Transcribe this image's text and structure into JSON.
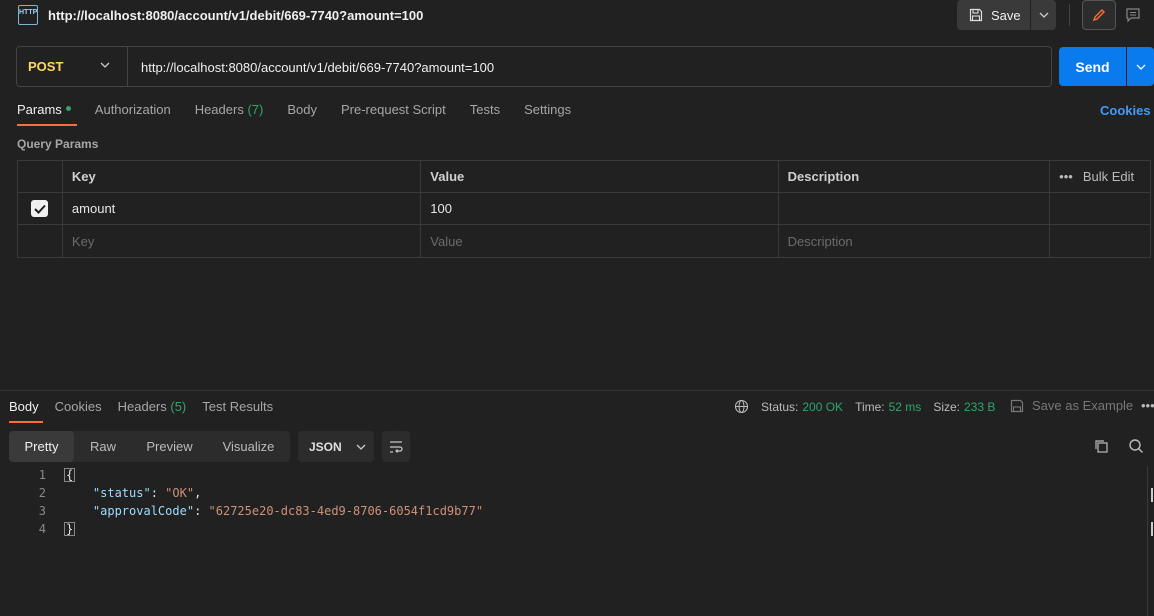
{
  "title": {
    "icon_label": "HTTP",
    "text": "http://localhost:8080/account/v1/debit/669-7740?amount=100",
    "save_label": "Save"
  },
  "request": {
    "method": "POST",
    "url": "http://localhost:8080/account/v1/debit/669-7740?amount=100",
    "send_label": "Send"
  },
  "req_tabs": {
    "params": "Params",
    "authorization": "Authorization",
    "headers": "Headers",
    "headers_count": "(7)",
    "body": "Body",
    "pre_request": "Pre-request Script",
    "tests": "Tests",
    "settings": "Settings",
    "cookies": "Cookies"
  },
  "query_params": {
    "title": "Query Params",
    "columns": {
      "key": "Key",
      "value": "Value",
      "description": "Description",
      "bulk_edit": "Bulk Edit"
    },
    "rows": [
      {
        "checked": true,
        "key": "amount",
        "value": "100",
        "description": ""
      }
    ],
    "placeholders": {
      "key": "Key",
      "value": "Value",
      "description": "Description"
    }
  },
  "response": {
    "tabs": {
      "body": "Body",
      "cookies": "Cookies",
      "headers": "Headers",
      "headers_count": "(5)",
      "test_results": "Test Results"
    },
    "status_label": "Status:",
    "status_value": "200 OK",
    "time_label": "Time:",
    "time_value": "52 ms",
    "size_label": "Size:",
    "size_value": "233 B",
    "save_example": "Save as Example",
    "views": {
      "pretty": "Pretty",
      "raw": "Raw",
      "preview": "Preview",
      "visualize": "Visualize"
    },
    "format": "JSON",
    "line_numbers": [
      "1",
      "2",
      "3",
      "4"
    ],
    "json": {
      "key1": "\"status\"",
      "val1": "\"OK\"",
      "key2": "\"approvalCode\"",
      "val2": "\"62725e20-dc83-4ed9-8706-6054f1cd9b77\""
    }
  },
  "colors": {
    "accent_orange": "#ff6c37",
    "send_blue": "#097bed",
    "method_yellow": "#ffd95c",
    "status_green": "#2ea66e",
    "link_blue": "#3e9bff"
  }
}
